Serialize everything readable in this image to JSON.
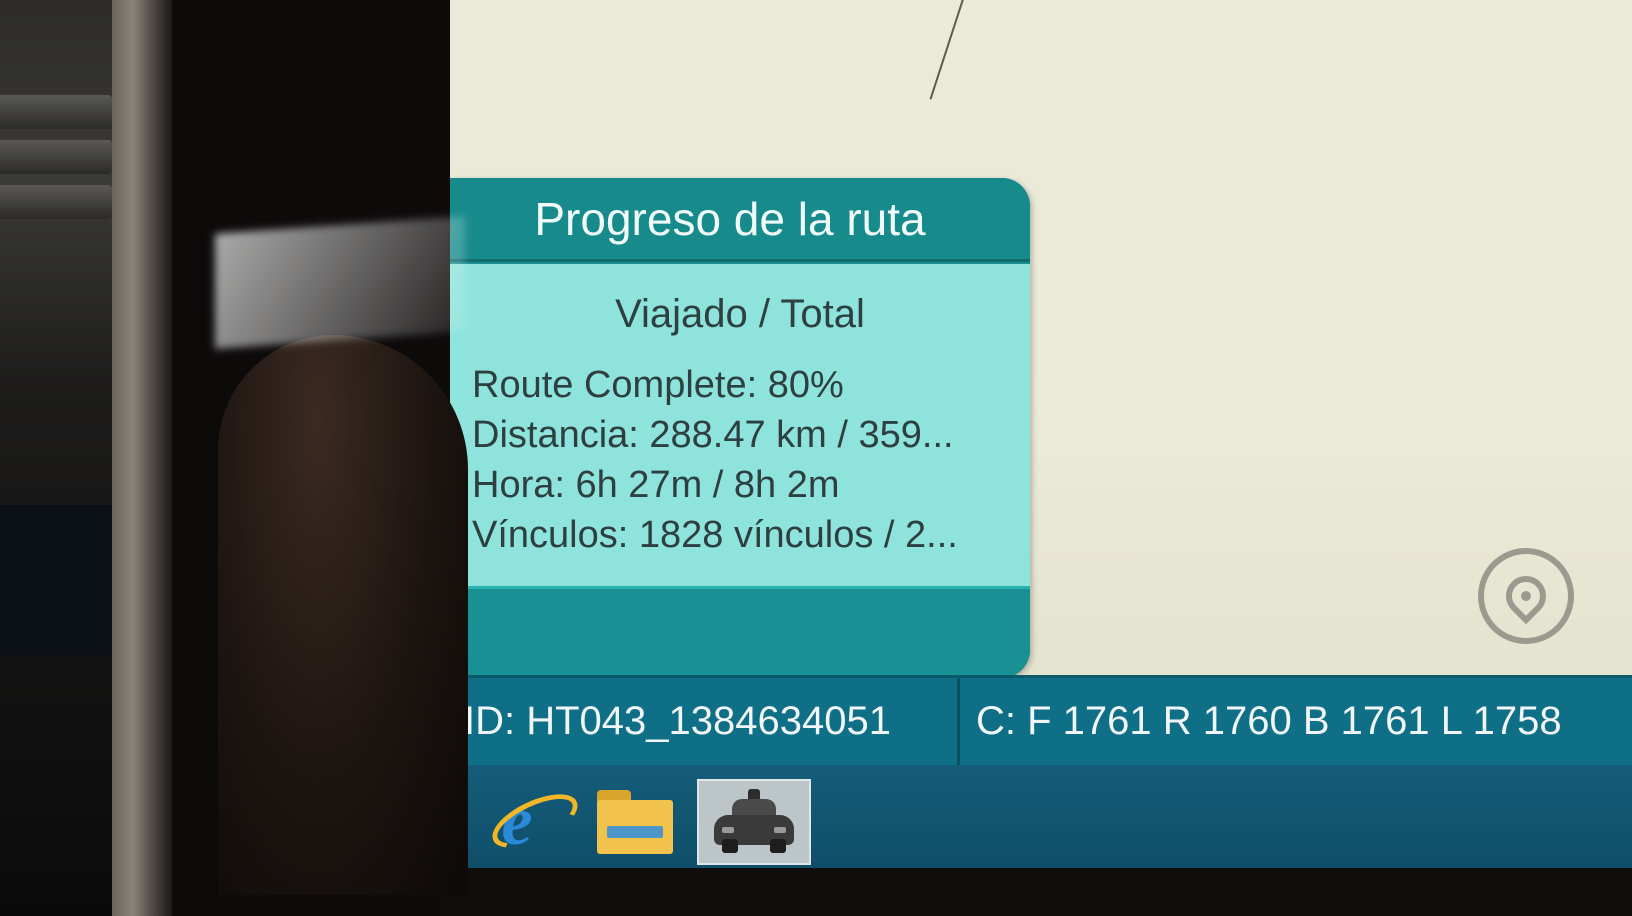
{
  "route_panel": {
    "title": "Progreso de la ruta",
    "subtitle": "Viajado / Total",
    "route_complete": "Route Complete: 80%",
    "distance": "Distancia: 288.47 km / 359...",
    "time": "Hora: 6h 27m / 8h 2m",
    "links": "Vínculos: 1828 vínculos / 2..."
  },
  "status_bar": {
    "id": "ID: HT043_1384634051",
    "counts": "C: F 1761 R 1760 B 1761 L 1758"
  },
  "taskbar": {
    "items": [
      {
        "icon": "internet-explorer-icon",
        "active": false
      },
      {
        "icon": "file-explorer-icon",
        "active": false
      },
      {
        "icon": "mapping-car-app-icon",
        "active": true
      }
    ]
  },
  "map": {
    "locate_icon": "location-pin-icon"
  },
  "colors": {
    "panel_teal": "#1b8e8f",
    "panel_body": "#8ee4dc",
    "status_bar": "#0e6f86",
    "map_background": "#e9ead8"
  }
}
